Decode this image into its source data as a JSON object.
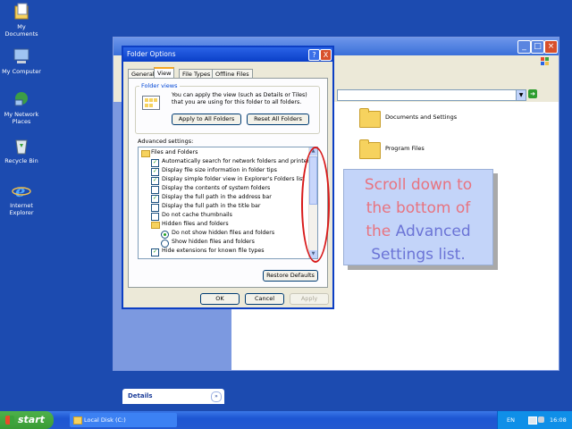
{
  "desktop": {
    "icons": [
      {
        "label": "My Documents",
        "icon": "my-documents-icon"
      },
      {
        "label": "My Computer",
        "icon": "my-computer-icon"
      },
      {
        "label": "My Network Places",
        "icon": "network-places-icon"
      },
      {
        "label": "Recycle Bin",
        "icon": "recycle-bin-icon"
      },
      {
        "label": "Internet Explorer",
        "icon": "internet-explorer-icon"
      }
    ]
  },
  "explorer": {
    "details_label": "Details",
    "folders": [
      {
        "label": "Documents and Settings"
      },
      {
        "label": "Program Files"
      }
    ]
  },
  "dialog": {
    "title": "Folder Options",
    "help_btn": "?",
    "close_btn": "X",
    "tabs": [
      {
        "label": "General"
      },
      {
        "label": "View"
      },
      {
        "label": "File Types"
      },
      {
        "label": "Offline Files"
      }
    ],
    "active_tab": "View",
    "folder_views": {
      "legend": "Folder views",
      "text": "You can apply the view (such as Details or Tiles) that you are using for this folder to all folders.",
      "apply_all": "Apply to All Folders",
      "reset_all": "Reset All Folders"
    },
    "advanced_label": "Advanced settings:",
    "advanced_items": [
      {
        "type": "folder",
        "label": "Files and Folders"
      },
      {
        "type": "check",
        "checked": true,
        "label": "Automatically search for network folders and printers"
      },
      {
        "type": "check",
        "checked": true,
        "label": "Display file size information in folder tips"
      },
      {
        "type": "check",
        "checked": true,
        "label": "Display simple folder view in Explorer's Folders list"
      },
      {
        "type": "check",
        "checked": false,
        "label": "Display the contents of system folders"
      },
      {
        "type": "check",
        "checked": true,
        "label": "Display the full path in the address bar"
      },
      {
        "type": "check",
        "checked": false,
        "label": "Display the full path in the title bar"
      },
      {
        "type": "check",
        "checked": false,
        "label": "Do not cache thumbnails"
      },
      {
        "type": "folder",
        "label": "Hidden files and folders"
      },
      {
        "type": "radio",
        "checked": true,
        "label": "Do not show hidden files and folders"
      },
      {
        "type": "radio",
        "checked": false,
        "label": "Show hidden files and folders"
      },
      {
        "type": "check",
        "checked": true,
        "label": "Hide extensions for known file types"
      }
    ],
    "restore_defaults": "Restore Defaults",
    "ok": "OK",
    "cancel": "Cancel",
    "apply": "Apply"
  },
  "callout": {
    "line1": "Scroll down to",
    "line2": "the bottom of",
    "line3a": "the ",
    "line3b": "Advanced",
    "line4": "Settings list."
  },
  "taskbar": {
    "start": "start",
    "task": "Local Disk (C:)",
    "lang": "EN",
    "clock": "16:08"
  },
  "colors": {
    "desktop": "#1c4bb0",
    "callout_text": "#e8737f",
    "callout_highlight": "#6b74d6",
    "annotation_circle": "#d81a1a"
  }
}
